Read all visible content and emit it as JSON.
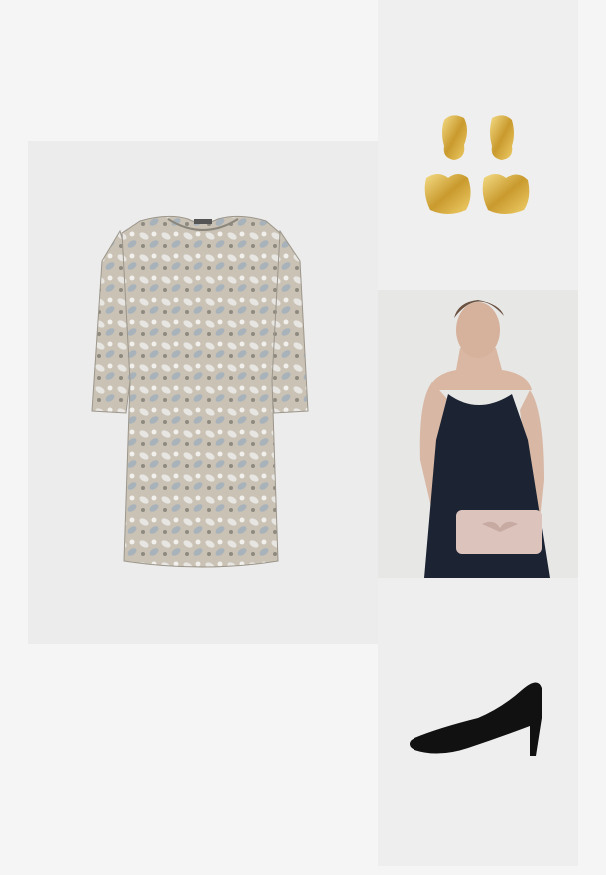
{
  "products": [
    {
      "item": "lace-shift-dress",
      "icon": "dress-icon",
      "color": "#b8b2a6"
    },
    {
      "item": "gold-earrings",
      "icon": "earrings-icon",
      "color": "#d9b64a"
    },
    {
      "item": "model-black-slip-dress-with-clutch",
      "icon": "model-photo-icon",
      "color": "#1c2433"
    },
    {
      "item": "black-suede-pump",
      "icon": "shoe-icon",
      "color": "#111111"
    }
  ]
}
